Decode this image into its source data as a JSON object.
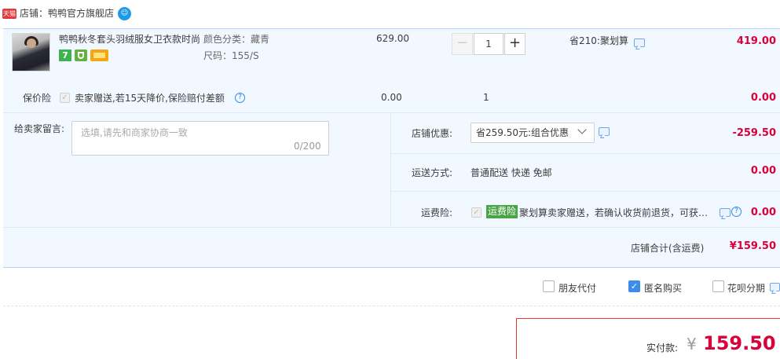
{
  "store": {
    "badge": "天猫",
    "name": "店铺：鸭鸭官方旗舰店",
    "chat_icon": "wangwang-chat-icon"
  },
  "item": {
    "title": "鸭鸭秋冬套头羽绒服女卫衣款时尚",
    "service_icons": [
      "seven-day-return-icon",
      "shield-guarantee-icon",
      "credit-card-icon"
    ],
    "service_7": "7",
    "sku_color": "颜色分类：藏青",
    "sku_size": "尺码：155/S",
    "price": "629.00",
    "quantity": "1",
    "minus": "−",
    "plus": "+",
    "promo": "省210:聚划算",
    "subtotal": "419.00"
  },
  "insurance": {
    "label": "保价险",
    "check": "✓",
    "text": "卖家赠送,若15天降价,保险赔付差额",
    "help": "?",
    "price": "0.00",
    "qty": "1",
    "amount": "0.00"
  },
  "message": {
    "label": "给卖家留言:",
    "placeholder": "选填,请先和商家协商一致",
    "count": "0/200"
  },
  "coupon": {
    "label": "店铺优惠:",
    "selected": "省259.50元:组合优惠",
    "amount": "-259.50"
  },
  "shipping": {
    "label": "运送方式:",
    "value": "普通配送 快递 免邮",
    "amount": "0.00"
  },
  "freight_insurance": {
    "label": "运费险:",
    "check": "✓",
    "tag": "运费险",
    "text": "聚划算卖家赠送，若确认收货前退货，可获…",
    "help": "?",
    "amount": "0.00"
  },
  "store_total": {
    "label": "店铺合计(含运费)",
    "amount": "¥159.50"
  },
  "options": {
    "friend_pay": "朋友代付",
    "anonymous": "匿名购买",
    "anonymous_check": "✓",
    "huabei": "花呗分期"
  },
  "payment": {
    "label": "实付款:",
    "symbol": "¥",
    "amount": "159.50"
  },
  "colors": {
    "accent_red": "#d8013a",
    "panel_bg": "#f2f8ff",
    "border_blue": "#b2d1ff",
    "checkbox_blue": "#3c8ce8"
  }
}
